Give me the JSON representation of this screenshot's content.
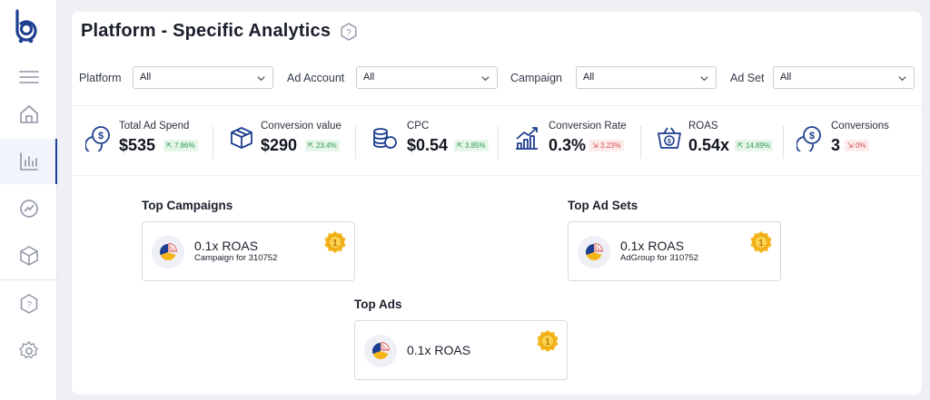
{
  "page": {
    "title": "Platform - Specific Analytics"
  },
  "filters": [
    {
      "label": "Platform",
      "value": "All"
    },
    {
      "label": "Ad Account",
      "value": "All"
    },
    {
      "label": "Campaign",
      "value": "All"
    },
    {
      "label": "Ad Set",
      "value": "All"
    }
  ],
  "stats": [
    {
      "label": "Total Ad Spend",
      "value": "$535",
      "change": "7.86%",
      "direction": "up",
      "icon": "dollar-coins-icon"
    },
    {
      "label": "Conversion value",
      "value": "$290",
      "change": "23.4%",
      "direction": "up",
      "icon": "box-icon"
    },
    {
      "label": "CPC",
      "value": "$0.54",
      "change": "3.85%",
      "direction": "up",
      "icon": "coin-stack-icon"
    },
    {
      "label": "Conversion Rate",
      "value": "0.3%",
      "change": "3.23%",
      "direction": "down",
      "icon": "bar-chart-trend-icon"
    },
    {
      "label": "ROAS",
      "value": "0.54x",
      "change": "14.89%",
      "direction": "up",
      "icon": "cart-dollar-icon"
    },
    {
      "label": "Conversions",
      "value": "3",
      "change": "0%",
      "direction": "down",
      "icon": "dollar-coins-icon"
    }
  ],
  "top_campaigns": {
    "title": "Top Campaigns",
    "roas": "0.1x ROAS",
    "sub": "Campaign for 310752",
    "rank": "1"
  },
  "top_ad_sets": {
    "title": "Top Ad Sets",
    "roas": "0.1x ROAS",
    "sub": "AdGroup for 310752",
    "rank": "1"
  },
  "top_ads": {
    "title": "Top Ads",
    "roas": "0.1x ROAS",
    "rank": "1"
  },
  "colors": {
    "brand": "#1d3f8f",
    "up": "#2c9a4b",
    "down": "#d84a4a",
    "medal": "#f4b41a"
  },
  "sidebar": {
    "icons": [
      "logo-icon",
      "menu-icon",
      "home-icon",
      "analytics-icon",
      "dashboard-gauge-icon",
      "package-icon",
      "help-icon",
      "settings-icon"
    ]
  }
}
